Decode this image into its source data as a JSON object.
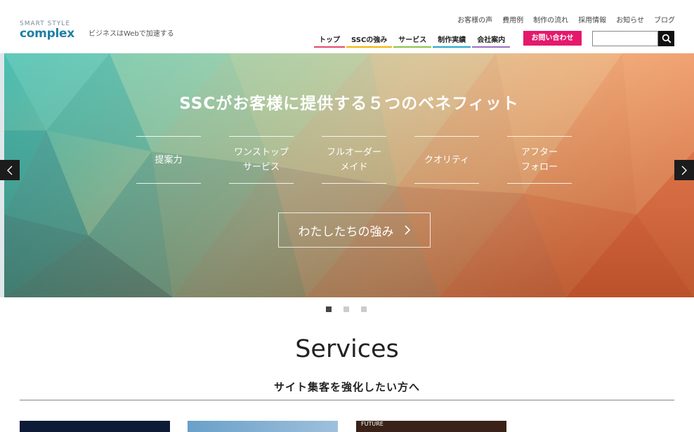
{
  "header": {
    "logo_small": "SMART STYLE",
    "logo_main": "complex",
    "tagline": "ビジネスはWebで加速する",
    "subnav": [
      "お客様の声",
      "費用例",
      "制作の流れ",
      "採用情報",
      "お知らせ",
      "ブログ"
    ],
    "mainnav": [
      "トップ",
      "SSCの強み",
      "サービス",
      "制作実績",
      "会社案内"
    ],
    "contact_label": "お問い合わせ",
    "search_placeholder": ""
  },
  "hero": {
    "title": "SSCがお客様に提供する５つのベネフィット",
    "benefits": [
      "提案力",
      "ワンストップ\nサービス",
      "フルオーダー\nメイド",
      "クオリティ",
      "アフター\nフォロー"
    ],
    "button_label": "わたしたちの強み",
    "slides": 3,
    "active_slide": 1
  },
  "services": {
    "title": "Services",
    "subtitle": "サイト集客を強化したい方へ",
    "thumb3_caption": "FUTURE"
  },
  "colors": {
    "accent": "#e4196b",
    "logo": "#1e7fa6"
  },
  "icons": {
    "search": "magnifier-icon",
    "prev": "chevron-left-icon",
    "next": "chevron-right-icon"
  }
}
